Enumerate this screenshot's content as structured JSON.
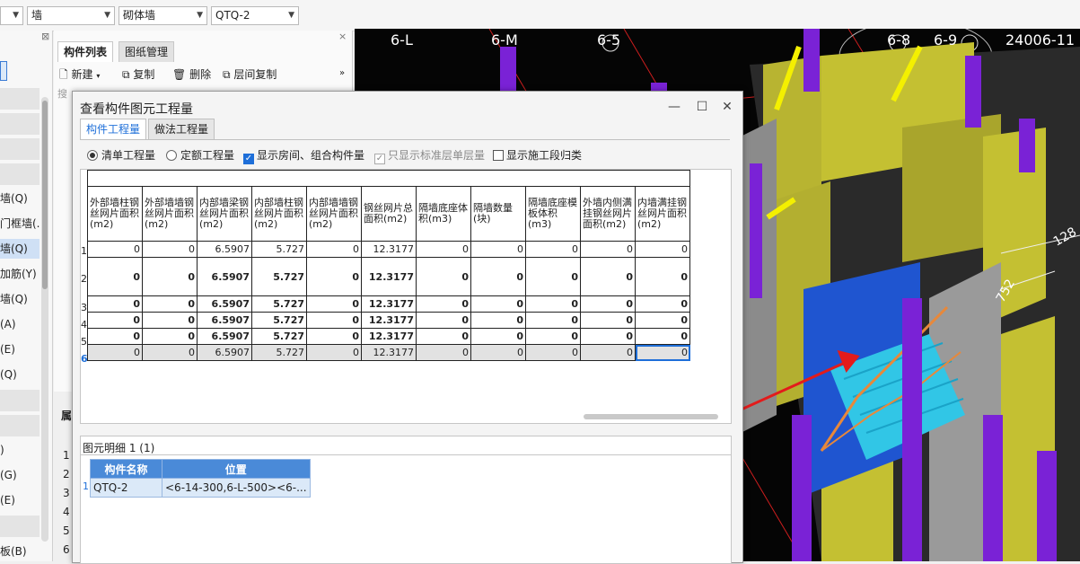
{
  "toolbar": {
    "combo1": "",
    "combo2": "墙",
    "combo3": "砌体墙",
    "combo4": "QTQ-2"
  },
  "left_panel": {
    "items": [
      "墙(Q)",
      "门框墙(.",
      "墙(Q)",
      "加筋(Y)",
      "墙(Q)",
      "(A)",
      "(E)",
      "(Q)",
      ")",
      "(G)",
      "(E)",
      "板(B)"
    ]
  },
  "component_panel": {
    "tab_list": "构件列表",
    "tab_drawing": "图纸管理",
    "new": "新建",
    "copy": "复制",
    "delete": "删除",
    "floor_copy": "层间复制",
    "search": "搜",
    "row_nums": [
      "1",
      "2",
      "3",
      "4",
      "5",
      "6"
    ]
  },
  "viewport": {
    "axis_labels": [
      "6-L",
      "6-M",
      "6-5",
      "6-8",
      "6-9",
      "24006-11"
    ],
    "dims": [
      "128",
      "752"
    ]
  },
  "dialog": {
    "title": "查看构件图元工程量",
    "tabs": [
      "构件工程量",
      "做法工程量"
    ],
    "opt_bill": "清单工程量",
    "opt_quota": "定额工程量",
    "chk_room": "显示房间、组合构件量",
    "chk_std": "只显示标准层单层量",
    "chk_stage": "显示施工段归类",
    "columns": [
      "外部墙柱钢丝网片面积(m2)",
      "外部墙墙钢丝网片面积(m2)",
      "内部墙梁钢丝网片面积(m2)",
      "内部墙柱钢丝网片面积(m2)",
      "内部墙墙钢丝网片面积(m2)",
      "钢丝网片总面积(m2)",
      "隔墙底座体积(m3)",
      "隔墙数量(块)",
      "隔墙底座模板体积(m3)",
      "外墙内侧满挂钢丝网片面积(m2)",
      "内墙满挂钢丝网片面积(m2)"
    ],
    "rows": [
      [
        "0",
        "0",
        "6.5907",
        "5.727",
        "0",
        "12.3177",
        "0",
        "0",
        "0",
        "0",
        "0"
      ],
      [
        "0",
        "0",
        "6.5907",
        "5.727",
        "0",
        "12.3177",
        "0",
        "0",
        "0",
        "0",
        "0"
      ],
      [
        "0",
        "0",
        "6.5907",
        "5.727",
        "0",
        "12.3177",
        "0",
        "0",
        "0",
        "0",
        "0"
      ],
      [
        "0",
        "0",
        "6.5907",
        "5.727",
        "0",
        "12.3177",
        "0",
        "0",
        "0",
        "0",
        "0"
      ],
      [
        "0",
        "0",
        "6.5907",
        "5.727",
        "0",
        "12.3177",
        "0",
        "0",
        "0",
        "0",
        "0"
      ],
      [
        "0",
        "0",
        "6.5907",
        "5.727",
        "0",
        "12.3177",
        "0",
        "0",
        "0",
        "0",
        "0"
      ]
    ],
    "row_labels": [
      "1",
      "2",
      "3",
      "4",
      "5",
      "6"
    ],
    "detail_label": "图元明细",
    "detail_count": "1 (1)",
    "detail_headers": [
      "构件名称",
      "位置"
    ],
    "detail_row": {
      "num": "1",
      "name": "QTQ-2",
      "pos": "<6-14-300,6-L-500><6-..."
    }
  },
  "colors": {
    "accent": "#1e6fd9",
    "header_blue": "#4a8ad8",
    "wall_yellow": "#c4c032",
    "column_purple": "#7a22d6"
  }
}
